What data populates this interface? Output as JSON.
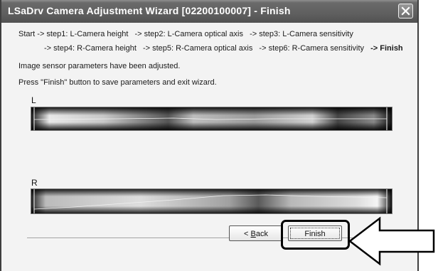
{
  "window": {
    "title": "LSaDrv Camera Adjustment Wizard [02200100007] - Finish"
  },
  "steps": {
    "row1": [
      "Start -> step1: L-Camera height",
      "-> step2: L-Camera optical axis",
      "-> step3: L-Camera sensitivity"
    ],
    "row2": [
      "-> step4: R-Camera height",
      "-> step5: R-Camera optical axis",
      "-> step6: R-Camera sensitivity"
    ],
    "finish": "-> Finish"
  },
  "messages": {
    "line1": "Image sensor parameters have been adjusted.",
    "line2": "Press \"Finish\" button to save parameters and exit wizard."
  },
  "sensors": {
    "left_label": "L",
    "right_label": "R"
  },
  "buttons": {
    "back_prefix": "< ",
    "back_hotkey": "B",
    "back_rest": "ack",
    "finish": "Finish"
  },
  "icons": {
    "close": "close-icon",
    "arrow": "pointer-arrow-icon"
  }
}
